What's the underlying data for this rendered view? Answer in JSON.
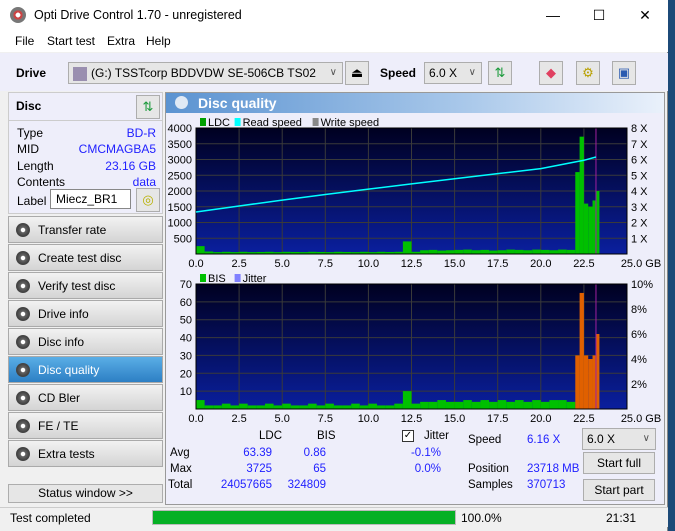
{
  "window": {
    "title": "Opti Drive Control 1.70 - unregistered",
    "minimize": "—",
    "maximize": "☐",
    "close": "✕"
  },
  "menu": [
    "File",
    "Start test",
    "Extra",
    "Help"
  ],
  "toolbar": {
    "drive_label": "Drive",
    "drive_value": "(G:)   TSSTcorp BDDVDW SE-506CB TS02",
    "speed_label": "Speed",
    "speed_value": "6.0 X",
    "icons": [
      "eject-icon",
      "refresh-icon",
      "eraser-icon",
      "settings-icon",
      "save-icon"
    ]
  },
  "disc": {
    "title": "Disc",
    "type_label": "Type",
    "type": "BD-R",
    "mid_label": "MID",
    "mid": "CMCMAGBA5",
    "length_label": "Length",
    "length": "23.16 GB",
    "contents_label": "Contents",
    "contents": "data",
    "label_label": "Label",
    "label": "Miecz_BR1"
  },
  "nav": [
    {
      "label": "Transfer rate"
    },
    {
      "label": "Create test disc"
    },
    {
      "label": "Verify test disc"
    },
    {
      "label": "Drive info"
    },
    {
      "label": "Disc info"
    },
    {
      "label": "Disc quality",
      "selected": true
    },
    {
      "label": "CD Bler"
    },
    {
      "label": "FE / TE"
    },
    {
      "label": "Extra tests"
    }
  ],
  "status_window": "Status window >>",
  "panel_title": "Disc quality",
  "chart_data": [
    {
      "type": "bar",
      "legend": [
        "LDC",
        "Read speed",
        "Write speed"
      ],
      "legend_colors": [
        "#00a000",
        "#00ffff",
        "#888888"
      ],
      "ylim": [
        0,
        4000
      ],
      "y_ticks": [
        "500",
        "1000",
        "1500",
        "2000",
        "2500",
        "3000",
        "3500",
        "4000"
      ],
      "y2_ticks": [
        "1 X",
        "2 X",
        "3 X",
        "4 X",
        "5 X",
        "6 X",
        "7 X",
        "8 X"
      ],
      "y2lim": [
        0,
        8
      ],
      "xlim": [
        0,
        25
      ],
      "x_ticks": [
        "0.0",
        "2.5",
        "5.0",
        "7.5",
        "10.0",
        "12.5",
        "15.0",
        "17.5",
        "20.0",
        "22.5",
        "25.0 GB"
      ],
      "grid": true,
      "ldc": {
        "x": [
          0,
          0.5,
          1,
          1.5,
          2,
          2.5,
          3,
          3.5,
          4,
          4.5,
          5,
          5.5,
          6,
          6.5,
          7,
          7.5,
          8,
          8.5,
          9,
          9.5,
          10,
          10.5,
          11,
          11.5,
          12,
          12.5,
          13,
          13.5,
          14,
          14.5,
          15,
          15.5,
          16,
          16.5,
          17,
          17.5,
          18,
          18.5,
          19,
          19.5,
          20,
          20.5,
          21,
          21.5,
          22,
          22.25,
          22.5,
          22.75,
          23,
          23.2
        ],
        "y": [
          250,
          80,
          60,
          70,
          60,
          70,
          60,
          65,
          70,
          60,
          70,
          65,
          60,
          70,
          65,
          60,
          70,
          65,
          60,
          70,
          60,
          70,
          65,
          70,
          400,
          70,
          120,
          130,
          110,
          120,
          130,
          140,
          120,
          130,
          110,
          120,
          140,
          130,
          120,
          140,
          130,
          120,
          140,
          130,
          2600,
          3725,
          1600,
          1500,
          1700,
          2000
        ]
      },
      "read_speed": {
        "x": [
          0,
          2.5,
          5,
          7.5,
          10,
          12.5,
          15,
          17.5,
          20,
          22.5,
          23.2
        ],
        "y": [
          2.67,
          3.05,
          3.42,
          3.78,
          4.12,
          4.45,
          4.78,
          5.1,
          5.42,
          5.95,
          6.16
        ]
      }
    },
    {
      "type": "bar",
      "legend": [
        "BIS",
        "Jitter"
      ],
      "legend_colors": [
        "#00c000",
        "#8080ff"
      ],
      "ylim": [
        0,
        70
      ],
      "y_ticks": [
        "10",
        "20",
        "30",
        "40",
        "50",
        "60",
        "70"
      ],
      "y2_ticks": [
        "2%",
        "4%",
        "6%",
        "8%",
        "10%"
      ],
      "y2lim": [
        0,
        10
      ],
      "xlim": [
        0,
        25
      ],
      "x_ticks": [
        "0.0",
        "2.5",
        "5.0",
        "7.5",
        "10.0",
        "12.5",
        "15.0",
        "17.5",
        "20.0",
        "22.5",
        "25.0 GB"
      ],
      "grid": true,
      "bis": {
        "x": [
          0,
          0.5,
          1,
          1.5,
          2,
          2.5,
          3,
          3.5,
          4,
          4.5,
          5,
          5.5,
          6,
          6.5,
          7,
          7.5,
          8,
          8.5,
          9,
          9.5,
          10,
          10.5,
          11,
          11.5,
          12,
          12.5,
          13,
          13.5,
          14,
          14.5,
          15,
          15.5,
          16,
          16.5,
          17,
          17.5,
          18,
          18.5,
          19,
          19.5,
          20,
          20.5,
          21,
          21.5,
          22,
          22.25,
          22.5,
          22.75,
          23,
          23.2
        ],
        "y": [
          5,
          2,
          2,
          3,
          2,
          3,
          2,
          2,
          3,
          2,
          3,
          2,
          2,
          3,
          2,
          3,
          2,
          2,
          3,
          2,
          3,
          2,
          2,
          3,
          10,
          3,
          4,
          4,
          5,
          4,
          4,
          5,
          4,
          5,
          4,
          5,
          4,
          5,
          4,
          5,
          4,
          5,
          5,
          4,
          30,
          65,
          30,
          28,
          30,
          42
        ]
      }
    }
  ],
  "stats": {
    "col_ldc": "LDC",
    "col_bis": "BIS",
    "jitter_label": "Jitter",
    "jitter_checked": true,
    "rows": [
      {
        "label": "Avg",
        "ldc": "63.39",
        "bis": "0.86",
        "jitter": "-0.1%"
      },
      {
        "label": "Max",
        "ldc": "3725",
        "bis": "65",
        "jitter": "0.0%"
      },
      {
        "label": "Total",
        "ldc": "24057665",
        "bis": "324809"
      }
    ],
    "speed_label": "Speed",
    "speed": "6.16 X",
    "position_label": "Position",
    "position": "23718 MB",
    "samples_label": "Samples",
    "samples": "370713",
    "speed_select": "6.0 X",
    "start_full": "Start full",
    "start_part": "Start part"
  },
  "status": {
    "text": "Test completed",
    "progress": 100.0,
    "progress_text": "100.0%",
    "time": "21:31",
    "progress_color": "#06b025"
  }
}
